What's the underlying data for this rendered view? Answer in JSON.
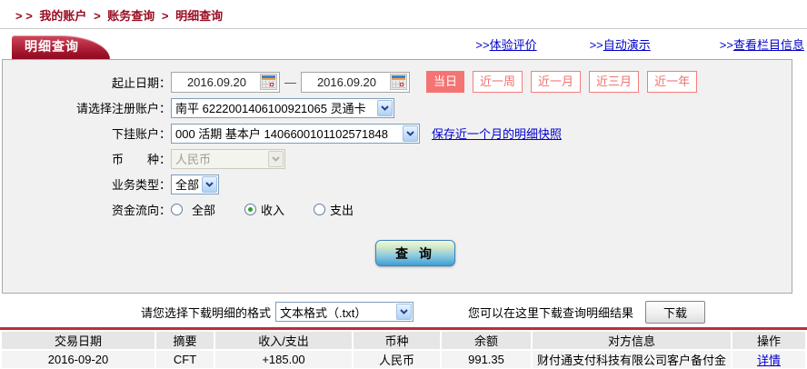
{
  "breadcrumb": {
    "prefix": "> >",
    "sep": ">",
    "items": [
      "我的账户",
      "账务查询",
      "明细查询"
    ]
  },
  "tab": {
    "title": "明细查询"
  },
  "top_links": [
    {
      "prefix": ">>",
      "label": "体验评价"
    },
    {
      "prefix": ">>",
      "label": "自动演示"
    },
    {
      "prefix": ">>",
      "label": "查看栏目信息"
    }
  ],
  "form": {
    "date_label": "起止日期：",
    "date_from": "2016.09.20",
    "date_to": "2016.09.20",
    "date_separator": "—",
    "quick_buttons": [
      {
        "label": "当日",
        "active": true
      },
      {
        "label": "近一周",
        "active": false
      },
      {
        "label": "近一月",
        "active": false
      },
      {
        "label": "近三月",
        "active": false
      },
      {
        "label": "近一年",
        "active": false
      }
    ],
    "register_account": {
      "label": "请选择注册账户：",
      "value": "南平  6222001406100921065  灵通卡"
    },
    "sub_account": {
      "label": "下挂账户：",
      "value": "000  活期  基本户  1406600101102571848",
      "snapshot_link": "保存近一个月的明细快照"
    },
    "currency": {
      "label": "币　　种：",
      "value": "人民币",
      "disabled": true
    },
    "business_type": {
      "label": "业务类型：",
      "value": "全部"
    },
    "fund_flow": {
      "label": "资金流向：",
      "options": [
        {
          "label": "全部",
          "checked": false
        },
        {
          "label": "收入",
          "checked": true
        },
        {
          "label": "支出",
          "checked": false
        }
      ]
    },
    "query_button": "查 询"
  },
  "download": {
    "format_label": "请您选择下载明细的格式",
    "format_value": "文本格式（.txt）",
    "hint": "您可以在这里下载查询明细结果",
    "button": "下载"
  },
  "table": {
    "headers": [
      "交易日期",
      "摘要",
      "收入/支出",
      "币种",
      "余额",
      "对方信息",
      "操作"
    ],
    "rows": [
      {
        "date": "2016-09-20",
        "summary": "CFT",
        "amount": "+185.00",
        "currency": "人民币",
        "balance": "991.35",
        "counterparty": "财付通支付科技有限公司客户备付金",
        "action": "详情"
      }
    ]
  },
  "colors": {
    "brand_red": "#9b0c22",
    "tab_red": "#a81c32",
    "salmon_accent": "#f57373",
    "link_blue": "#0000cc",
    "amount_red": "#d40000",
    "table_line_red": "#bf2c39",
    "panel_gray": "#f1f1f1"
  }
}
